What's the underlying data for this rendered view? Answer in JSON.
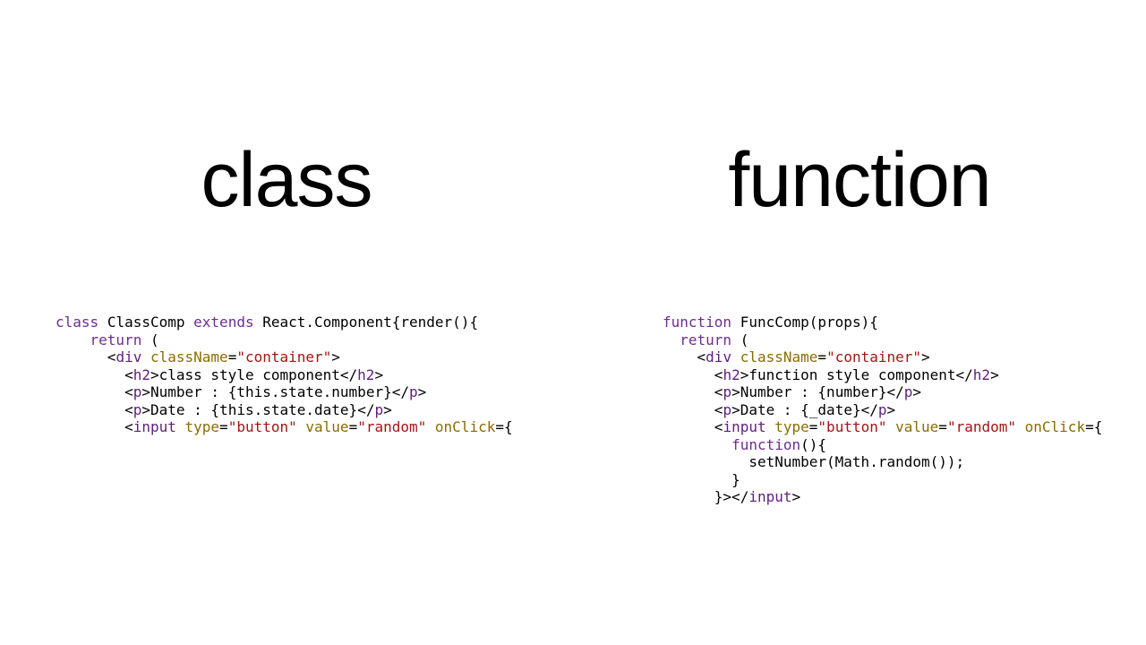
{
  "left": {
    "title": "class",
    "code": {
      "keywords": {
        "class": "class",
        "extends": "extends",
        "return": "return"
      },
      "ids": {
        "name": "ClassComp",
        "base": "React.Component",
        "render": "render"
      },
      "attrs": {
        "className": "className",
        "type": "type",
        "value": "value",
        "onClick": "onClick"
      },
      "strings": {
        "container": "\"container\"",
        "button": "\"button\"",
        "random": "\"random\""
      },
      "texts": {
        "h2": "class style component",
        "numberLabel": "Number : ",
        "numberExpr": "{this.state.number}",
        "dateLabel": "Date : ",
        "dateExpr": "{this.state.date}"
      },
      "literals": {
        "openParen": "(){",
        "renderOpen": " (",
        "eqBrace": "={"
      }
    }
  },
  "right": {
    "title": "function",
    "code": {
      "keywords": {
        "function": "function",
        "return": "return"
      },
      "ids": {
        "name": "FuncComp",
        "props": "props"
      },
      "attrs": {
        "className": "className",
        "type": "type",
        "value": "value",
        "onClick": "onClick"
      },
      "strings": {
        "container": "\"container\"",
        "button": "\"button\"",
        "random": "\"random\""
      },
      "texts": {
        "h2": "function style component",
        "numberLabel": "Number : ",
        "numberExpr": "{number}",
        "dateLabel": "Date : ",
        "dateExpr": "{_date}",
        "setNumberCall": "setNumber(Math.random());"
      },
      "literals": {
        "fnOpen": "(",
        "fnClose": "){",
        "renderOpen": " (",
        "eqBrace": "={",
        "anonFn": "(){",
        "closeBrace": "}",
        "closeJsx": "}>"
      }
    }
  }
}
